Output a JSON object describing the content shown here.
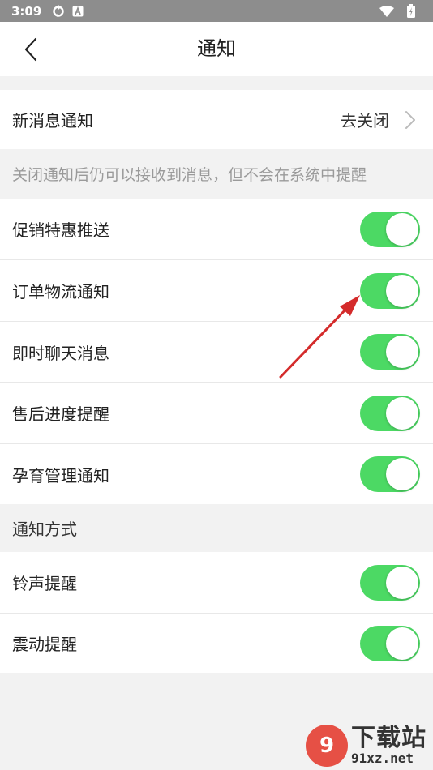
{
  "status_bar": {
    "time": "3:09",
    "icons": [
      "sync-icon",
      "a-box-icon"
    ],
    "right_icons": [
      "wifi-icon",
      "battery-icon"
    ]
  },
  "nav": {
    "title": "通知",
    "back_icon": "chevron-left-icon"
  },
  "new_message": {
    "label": "新消息通知",
    "value": "去关闭",
    "chevron_icon": "chevron-right-icon"
  },
  "hint": "关闭通知后仍可以接收到消息，但不会在系统中提醒",
  "notification_items": [
    {
      "label": "促销特惠推送",
      "on": true
    },
    {
      "label": "订单物流通知",
      "on": true
    },
    {
      "label": "即时聊天消息",
      "on": true
    },
    {
      "label": "售后进度提醒",
      "on": true
    },
    {
      "label": "孕育管理通知",
      "on": true
    }
  ],
  "method_section": "通知方式",
  "method_items": [
    {
      "label": "铃声提醒",
      "on": true
    },
    {
      "label": "震动提醒",
      "on": true
    }
  ],
  "colors": {
    "toggle_on": "#4cd964",
    "arrow": "#d42b2b",
    "status_bar": "#8d8d8d"
  },
  "watermark": {
    "badge": "9",
    "main": "下载站",
    "sub": "91xz.net"
  }
}
